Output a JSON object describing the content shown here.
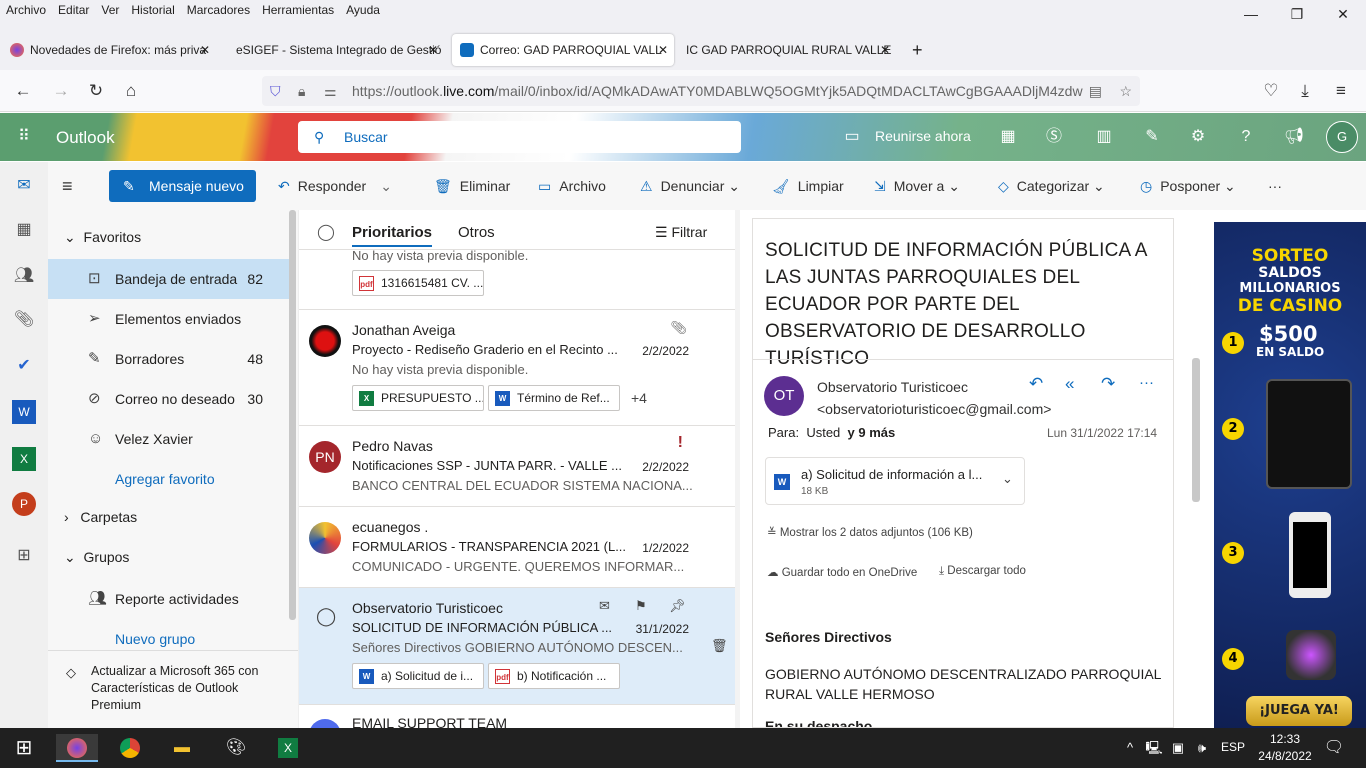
{
  "menubar": [
    "Archivo",
    "Editar",
    "Ver",
    "Historial",
    "Marcadores",
    "Herramientas",
    "Ayuda"
  ],
  "browser": {
    "tabs": [
      {
        "label": "Novedades de Firefox: más priva"
      },
      {
        "label": "eSIGEF - Sistema Integrado de Gestió"
      },
      {
        "label": "Correo: GAD PARROQUIAL VALL"
      },
      {
        "label": "IC GAD PARROQUIAL RURAL VALLE"
      }
    ],
    "url_prefix": "https://outlook.",
    "url_domain": "live.com",
    "url_path": "/mail/0/inbox/id/AQMkADAwATY0MDABLWQ5OGMtYjk5ADQtMDACLTAwCgBGAAADljM4zdw"
  },
  "outlook": {
    "app_name": "Outlook",
    "search_placeholder": "Buscar",
    "meet_now": "Reunirse ahora",
    "avatar_initial": "G",
    "commands": {
      "new_message": "Mensaje nuevo",
      "reply": "Responder",
      "delete": "Eliminar",
      "archive": "Archivo",
      "report": "Denunciar",
      "sweep": "Limpiar",
      "move": "Mover a",
      "categorize": "Categorizar",
      "snooze": "Posponer",
      "more": "···"
    },
    "folders": {
      "favorites": "Favoritos",
      "items": [
        {
          "label": "Bandeja de entrada",
          "count": "82"
        },
        {
          "label": "Elementos enviados",
          "count": ""
        },
        {
          "label": "Borradores",
          "count": "48"
        },
        {
          "label": "Correo no deseado",
          "count": "30"
        },
        {
          "label": "Velez Xavier",
          "count": ""
        }
      ],
      "add_favorite": "Agregar favorito",
      "folders_label": "Carpetas",
      "groups_label": "Grupos",
      "group_item": "Reporte actividades",
      "new_group": "Nuevo grupo",
      "upgrade": "Actualizar a Microsoft 365 con Características de Outlook Premium"
    },
    "list": {
      "tab_focused": "Prioritarios",
      "tab_other": "Otros",
      "filter": "Filtrar",
      "partial_top": {
        "preview": "No hay vista previa disponible.",
        "attachment": "1316615481 CV. ..."
      },
      "messages": [
        {
          "from": "Jonathan Aveiga",
          "subject": "Proyecto - Rediseño Graderio en el Recinto ...",
          "date": "2/2/2022",
          "preview": "No hay vista previa disponible.",
          "attachments": [
            "PRESUPUESTO ...",
            "Término de Ref..."
          ],
          "more": "+4"
        },
        {
          "from": "Pedro Navas",
          "initials": "PN",
          "subject": "Notificaciones SSP - JUNTA PARR. - VALLE ...",
          "date": "2/2/2022",
          "preview": "BANCO CENTRAL DEL ECUADOR SISTEMA NACIONA..."
        },
        {
          "from": "ecuanegos .",
          "subject": "FORMULARIOS - TRANSPARENCIA 2021 (L...",
          "date": "1/2/2022",
          "preview": "COMUNICADO - URGENTE. QUEREMOS INFORMAR..."
        },
        {
          "from": "Observatorio Turisticoec",
          "subject": "SOLICITUD DE INFORMACIÓN PÚBLICA ...",
          "date": "31/1/2022",
          "preview": "Señores Directivos GOBIERNO AUTÓNOMO DESCEN...",
          "attachments": [
            "a) Solicitud de i...",
            "b) Notificación ..."
          ]
        },
        {
          "from": "EMAIL SUPPORT TEAM"
        }
      ]
    },
    "reading": {
      "subject": "SOLICITUD DE INFORMACIÓN PÚBLICA A LAS JUNTAS PARROQUIALES DEL ECUADOR POR PARTE DEL OBSERVATORIO DE DESARROLLO TURÍSTICO",
      "sender_initials": "OT",
      "sender_name": "Observatorio Turisticoec",
      "sender_email": "<observatorioturisticoec@gmail.com>",
      "to_label": "Para:",
      "to_value": "Usted",
      "to_more": "y 9 más",
      "date": "Lun 31/1/2022 17:14",
      "attachment_name": "a) Solicitud de información a l...",
      "attachment_size": "18 KB",
      "show_all": "Mostrar los 2 datos adjuntos (106 KB)",
      "save_onedrive": "Guardar todo en OneDrive",
      "download_all": "Descargar todo",
      "body_greeting": "Señores Directivos",
      "body_line": "GOBIERNO AUTÓNOMO DESCENTRALIZADO PARROQUIAL RURAL VALLE HERMOSO",
      "body_next": "En su despacho"
    },
    "ad": {
      "l1": "SORTEO",
      "l2": "SALDOS",
      "l3": "MILLONARIOS",
      "l4": "DE CASINO",
      "prize1": "$500",
      "prize1_sub": "EN SALDO",
      "n1": "1",
      "n2": "2",
      "n3": "3",
      "n4": "4",
      "cta": "¡JUEGA YA!"
    }
  },
  "taskbar": {
    "lang": "ESP",
    "time": "12:33",
    "date": "24/8/2022"
  },
  "colors": {
    "accent": "#0f6cbd",
    "selected_folder": "#c7e0f4",
    "selected_message": "#deecf9",
    "taskbar": "#202020"
  }
}
